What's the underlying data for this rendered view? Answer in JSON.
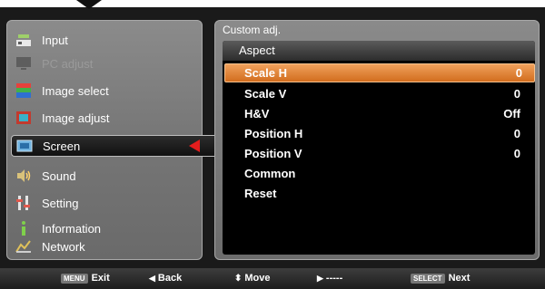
{
  "sidebar": {
    "items": [
      {
        "label": "Input",
        "icon": "input-icon",
        "state": "normal"
      },
      {
        "label": "PC adjust",
        "icon": "pc-adjust-icon",
        "state": "disabled"
      },
      {
        "label": "Image select",
        "icon": "image-select-icon",
        "state": "normal"
      },
      {
        "label": "Image adjust",
        "icon": "image-adjust-icon",
        "state": "normal"
      },
      {
        "label": "Screen",
        "icon": "screen-icon",
        "state": "active"
      },
      {
        "label": "Sound",
        "icon": "sound-icon",
        "state": "normal"
      },
      {
        "label": "Setting",
        "icon": "setting-icon",
        "state": "normal"
      },
      {
        "label": "Information",
        "icon": "information-icon",
        "state": "normal"
      },
      {
        "label": "Network",
        "icon": "network-icon",
        "state": "normal"
      }
    ]
  },
  "main": {
    "title": "Custom adj.",
    "section": "Aspect",
    "rows": [
      {
        "label": "Scale H",
        "value": "0"
      },
      {
        "label": "Scale V",
        "value": "0"
      },
      {
        "label": "H&V",
        "value": "Off"
      },
      {
        "label": "Position H",
        "value": "0"
      },
      {
        "label": "Position V",
        "value": "0"
      },
      {
        "label": "Common",
        "value": ""
      },
      {
        "label": "Reset",
        "value": ""
      }
    ],
    "selected_row": "Scale H"
  },
  "footer": {
    "exit_key": "MENU",
    "exit_label": "Exit",
    "back_label": "Back",
    "move_label": "Move",
    "right_label": "-----",
    "next_key": "SELECT",
    "next_label": "Next"
  },
  "colors": {
    "highlight": "#e07a28",
    "pointer": "#e31d1d"
  }
}
